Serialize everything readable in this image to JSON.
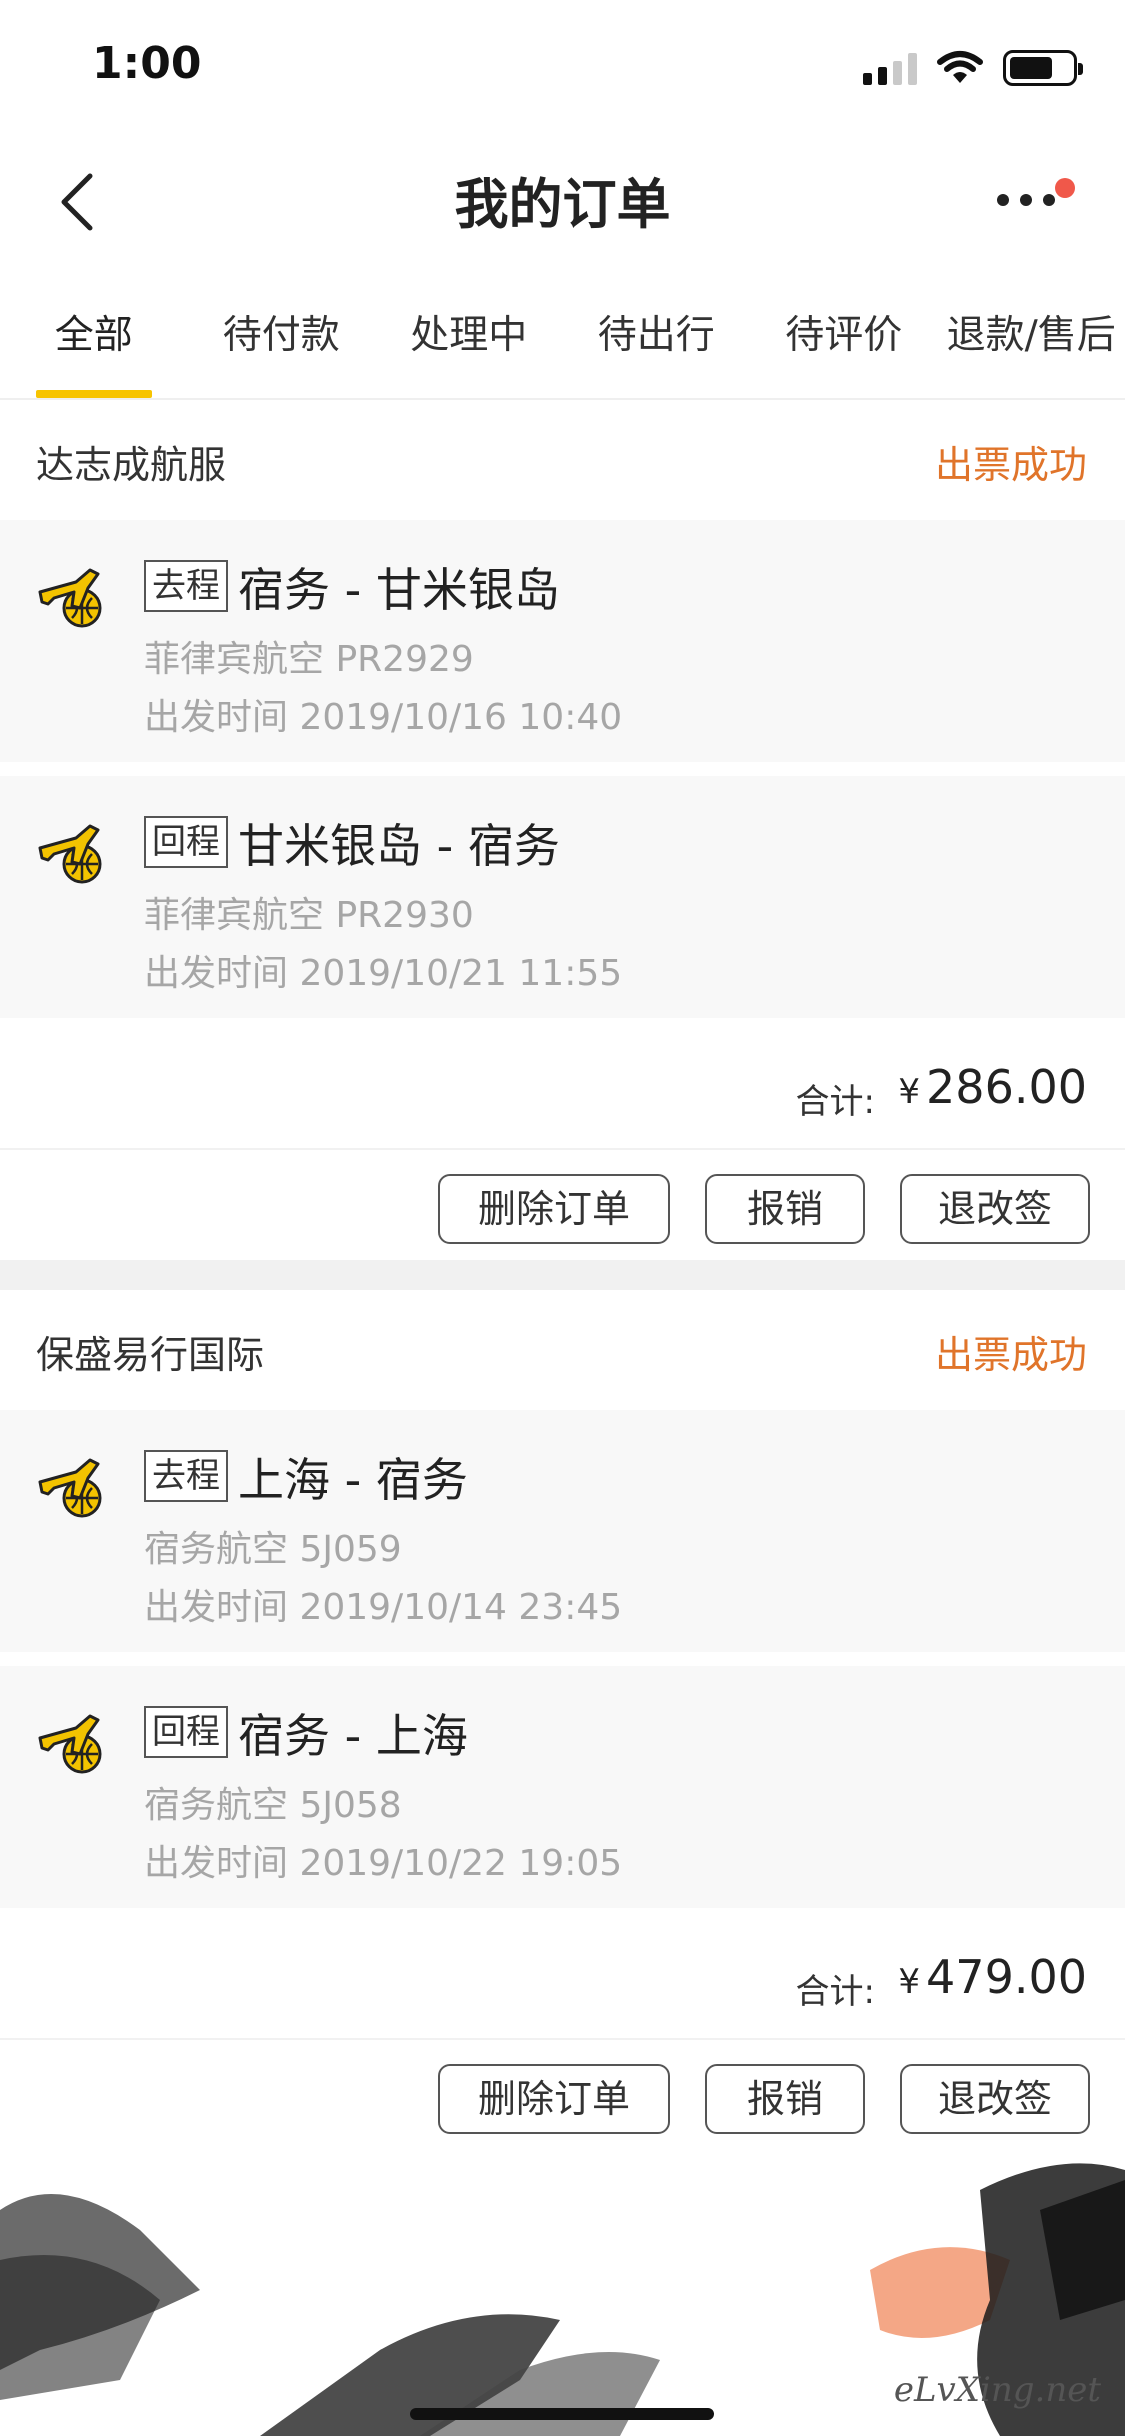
{
  "status_bar": {
    "time": "1:00"
  },
  "nav": {
    "title": "我的订单"
  },
  "tabs": [
    {
      "label": "全部"
    },
    {
      "label": "待付款"
    },
    {
      "label": "处理中"
    },
    {
      "label": "待出行"
    },
    {
      "label": "待评价"
    },
    {
      "label": "退款/售后"
    }
  ],
  "orders": [
    {
      "agency": "达志成航服",
      "status": "出票成功",
      "segments": [
        {
          "type": "去程",
          "route": "宿务 - 甘米银岛",
          "airline": "菲律宾航空 PR2929",
          "depart": "出发时间 2019/10/16 10:40"
        },
        {
          "type": "回程",
          "route": "甘米银岛 - 宿务",
          "airline": "菲律宾航空 PR2930",
          "depart": "出发时间 2019/10/21 11:55"
        }
      ],
      "total_label": "合计:",
      "currency": "¥",
      "total": "286.00",
      "buttons": {
        "delete": "删除订单",
        "reimburse": "报销",
        "change": "退改签"
      }
    },
    {
      "agency": "保盛易行国际",
      "status": "出票成功",
      "segments": [
        {
          "type": "去程",
          "route": "上海 - 宿务",
          "airline": "宿务航空 5J059",
          "depart": "出发时间 2019/10/14 23:45"
        },
        {
          "type": "回程",
          "route": "宿务 - 上海",
          "airline": "宿务航空 5J058",
          "depart": "出发时间 2019/10/22 19:05"
        }
      ],
      "total_label": "合计:",
      "currency": "¥",
      "total": "479.00",
      "buttons": {
        "delete": "删除订单",
        "reimburse": "报销",
        "change": "退改签"
      }
    }
  ],
  "watermark": "eLvXing.net",
  "colors": {
    "accent": "#f7c400",
    "status": "#e0742a",
    "badge": "#f0584a"
  },
  "icons": [
    "back-arrow-icon",
    "more-dots-icon",
    "plane-icon",
    "signal-icon",
    "wifi-icon",
    "battery-icon"
  ]
}
